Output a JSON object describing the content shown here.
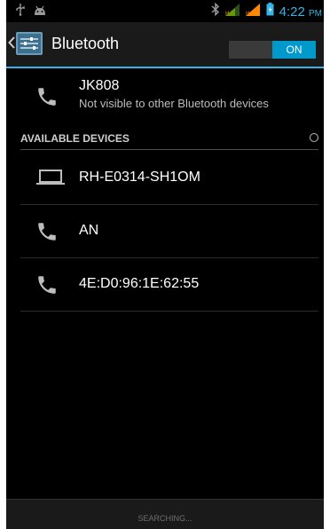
{
  "status_bar": {
    "time": "4:22",
    "ampm": "PM"
  },
  "action_bar": {
    "title": "Bluetooth",
    "toggle_label": "ON"
  },
  "this_device": {
    "name": "JK808",
    "visibility": "Not visible to other Bluetooth devices"
  },
  "available_devices": {
    "header": "AVAILABLE DEVICES",
    "items": [
      {
        "name": "RH-E0314-SH1OM",
        "icon": "laptop-icon"
      },
      {
        "name": "AN",
        "icon": "phone-icon"
      },
      {
        "name": "4E:D0:96:1E:62:55",
        "icon": "phone-icon"
      }
    ]
  },
  "bottom_bar": {
    "label": "SEARCHING..."
  },
  "colors": {
    "accent": "#33b5e5",
    "switch_on": "#0099cc",
    "background": "#000000"
  }
}
